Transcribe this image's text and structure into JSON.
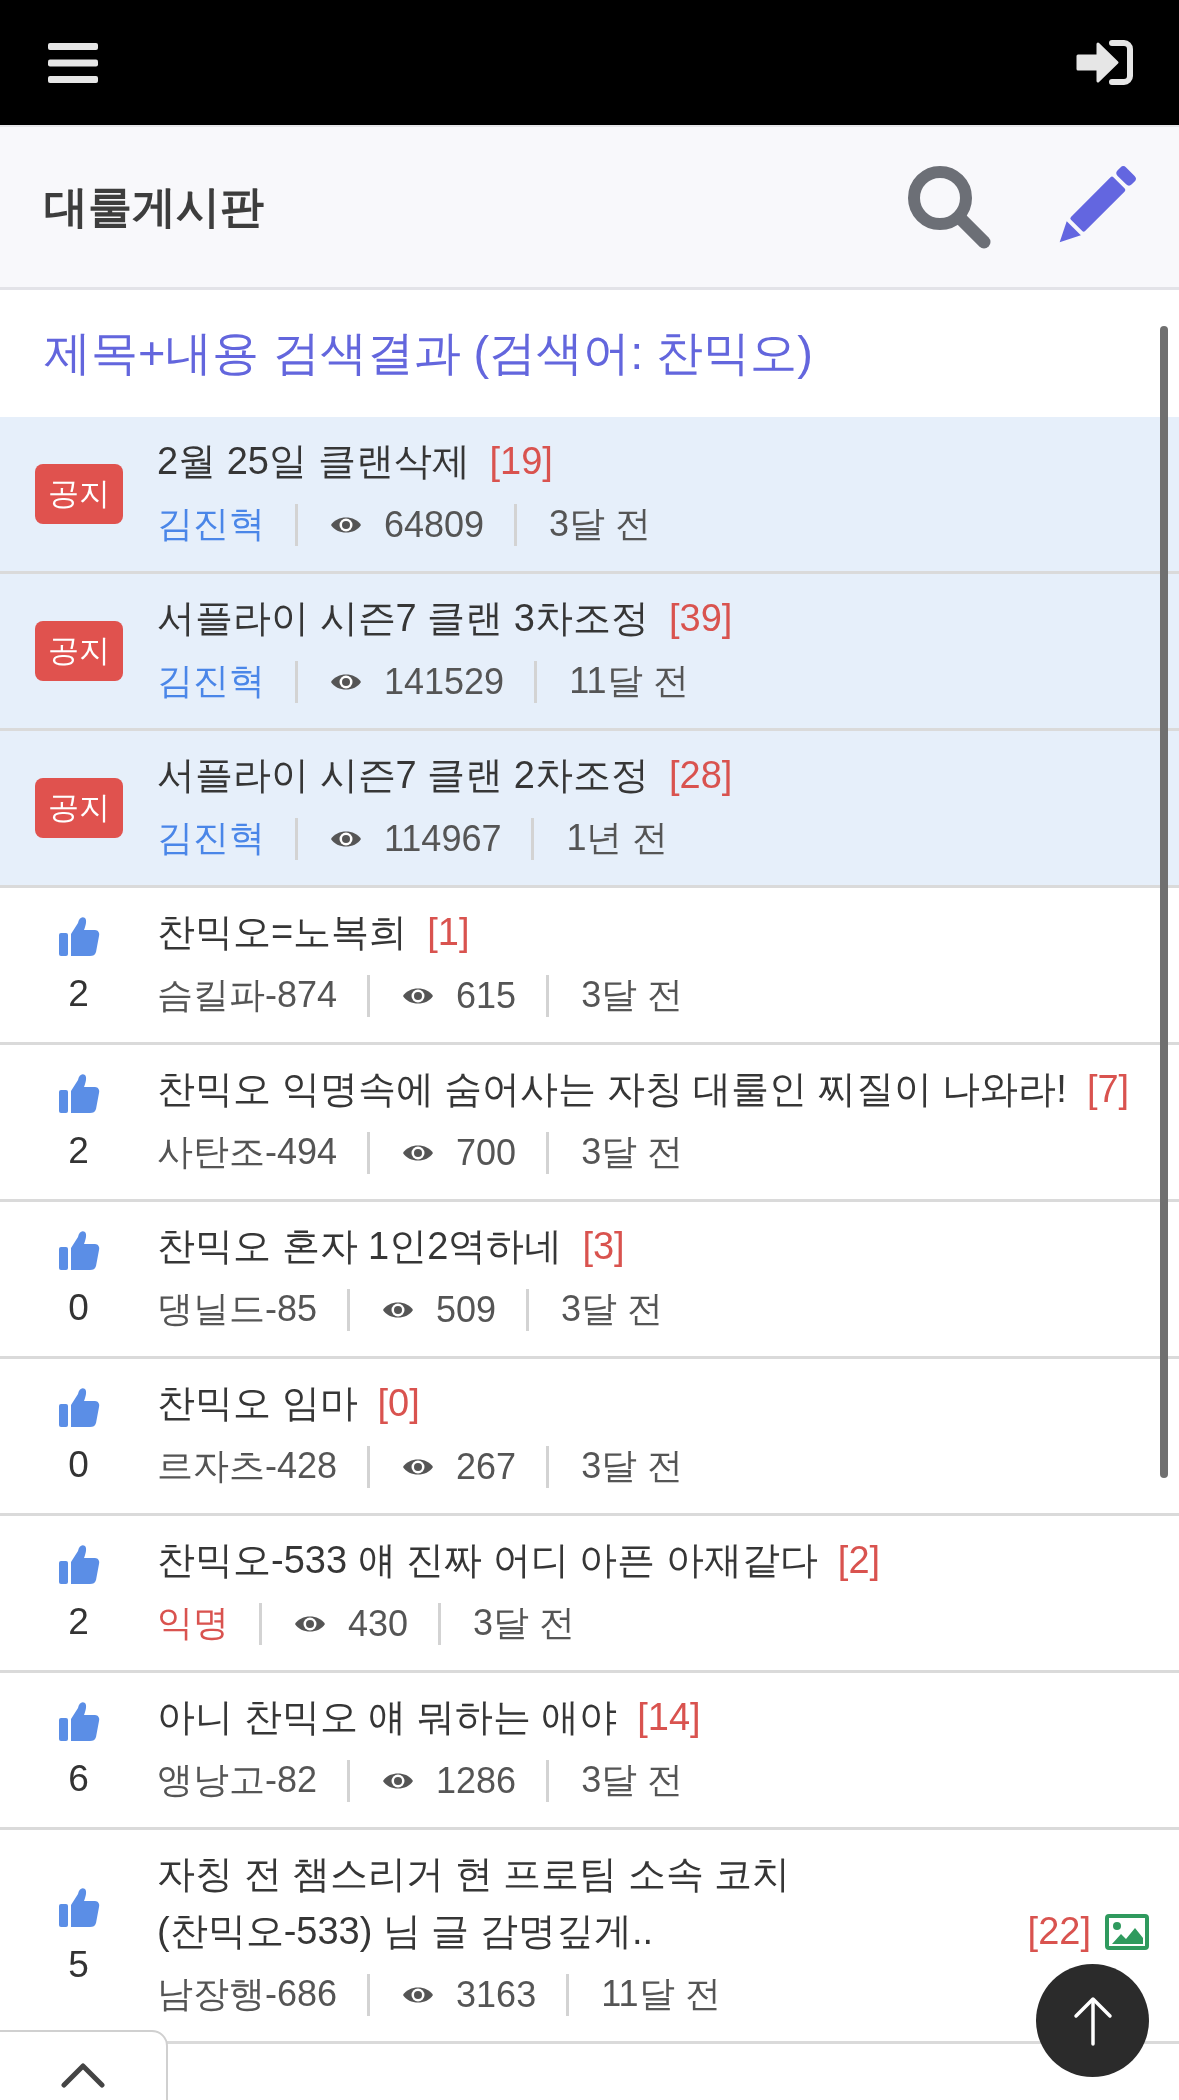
{
  "board": {
    "title": "대룰게시판"
  },
  "search_heading": "제목+내용 검색결과 (검색어: 찬믹오)",
  "posts": [
    {
      "kind": "notice",
      "badge": "공지",
      "title": "2월 25일 클랜삭제",
      "comments": "[19]",
      "has_image": false,
      "author": {
        "name": "김진혁",
        "color": "#4a86e8"
      },
      "views": "64809",
      "time": "3달 전"
    },
    {
      "kind": "notice",
      "badge": "공지",
      "title": "서플라이 시즌7 클랜 3차조정",
      "comments": "[39]",
      "has_image": false,
      "author": {
        "name": "김진혁",
        "color": "#4a86e8"
      },
      "views": "141529",
      "time": "11달 전"
    },
    {
      "kind": "notice",
      "badge": "공지",
      "title": "서플라이 시즌7 클랜 2차조정",
      "comments": "[28]",
      "has_image": false,
      "author": {
        "name": "김진혁",
        "color": "#4a86e8"
      },
      "views": "114967",
      "time": "1년 전"
    },
    {
      "kind": "post",
      "likes": "2",
      "title": "찬믹오=노복희",
      "comments": "[1]",
      "has_image": false,
      "author": {
        "name": "슴킬파-874",
        "color": "#555555"
      },
      "views": "615",
      "time": "3달 전"
    },
    {
      "kind": "post",
      "likes": "2",
      "title": "찬믹오 익명속에 숨어사는 자칭 대룰인 찌질이 나와라!",
      "comments": "[7]",
      "has_image": false,
      "author": {
        "name": "사탄조-494",
        "color": "#555555"
      },
      "views": "700",
      "time": "3달 전"
    },
    {
      "kind": "post",
      "likes": "0",
      "title": "찬믹오 혼자 1인2역하네",
      "comments": "[3]",
      "has_image": false,
      "author": {
        "name": "댕닐드-85",
        "color": "#555555"
      },
      "views": "509",
      "time": "3달 전"
    },
    {
      "kind": "post",
      "likes": "0",
      "title": "찬믹오 임마",
      "comments": "[0]",
      "has_image": false,
      "author": {
        "name": "르자츠-428",
        "color": "#555555"
      },
      "views": "267",
      "time": "3달 전"
    },
    {
      "kind": "post",
      "likes": "2",
      "title": "찬믹오-533 얘 진짜 어디 아픈 아재같다",
      "comments": "[2]",
      "has_image": false,
      "author": {
        "name": "익명",
        "color": "#d9534f"
      },
      "views": "430",
      "time": "3달 전"
    },
    {
      "kind": "post",
      "likes": "6",
      "title": "아니 찬믹오 얘 뭐하는 애야",
      "comments": "[14]",
      "has_image": false,
      "author": {
        "name": "앵낭고-82",
        "color": "#555555"
      },
      "views": "1286",
      "time": "3달 전"
    },
    {
      "kind": "post",
      "likes": "5",
      "title": "자칭 전 챔스리거 현 프로팀 소속 코치 (찬믹오-533) 님 글 감명깊게..",
      "comments": "[22]",
      "has_image": true,
      "author": {
        "name": "남장행-686",
        "color": "#555555"
      },
      "views": "3163",
      "time": "11달 전"
    }
  ]
}
